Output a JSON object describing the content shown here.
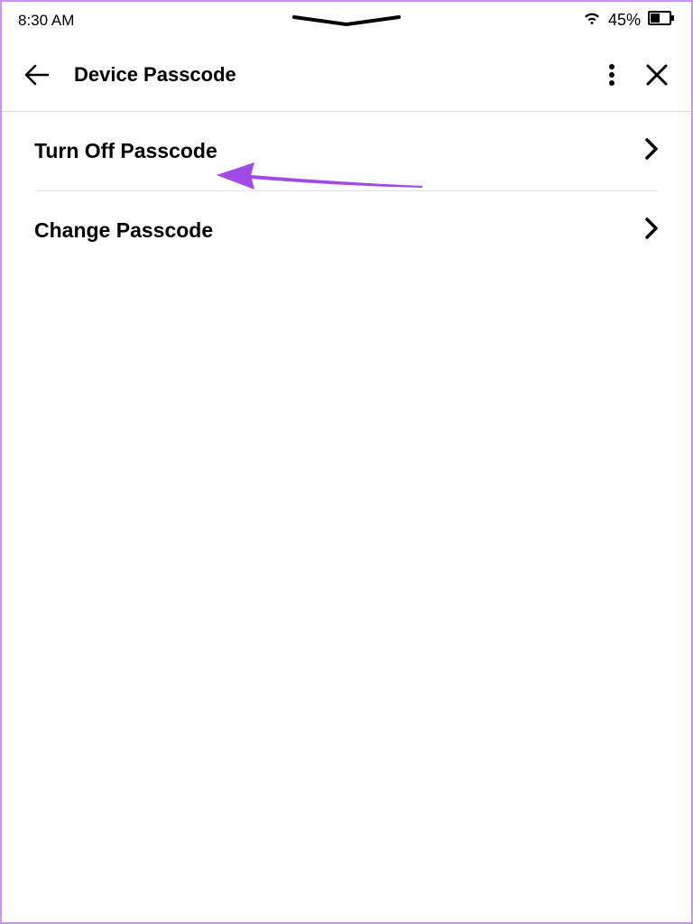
{
  "statusBar": {
    "time": "8:30 AM",
    "battery": "45%"
  },
  "header": {
    "title": "Device Passcode"
  },
  "menu": {
    "items": [
      {
        "label": "Turn Off Passcode"
      },
      {
        "label": "Change Passcode"
      }
    ]
  },
  "annotation": {
    "color": "#a04be8"
  }
}
